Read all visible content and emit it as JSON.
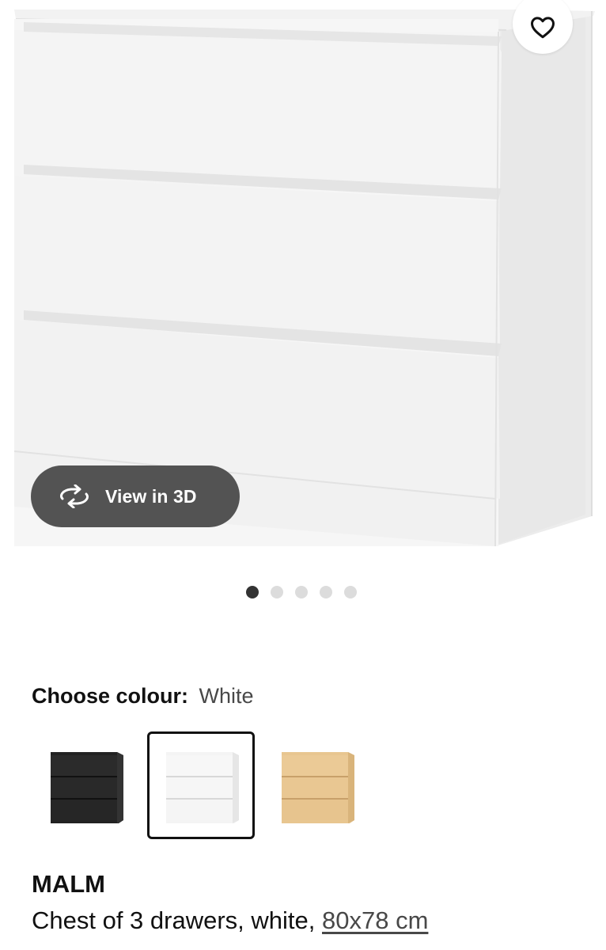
{
  "gallery": {
    "view_in_3d_label": "View in 3D",
    "image_count": 5,
    "active_index": 0
  },
  "colour": {
    "title": "Choose colour:",
    "selected": "White",
    "options": [
      {
        "name": "black-brown",
        "color": "#2a2a2a"
      },
      {
        "name": "white",
        "color": "#f4f4f4"
      },
      {
        "name": "oak-veneer",
        "color": "#e6c48f"
      }
    ]
  },
  "product": {
    "name": "MALM",
    "description": "Chest of 3 drawers, white,",
    "size": "80x78 cm"
  },
  "colors": {
    "accent_dark": "#535353",
    "text": "#111111"
  }
}
